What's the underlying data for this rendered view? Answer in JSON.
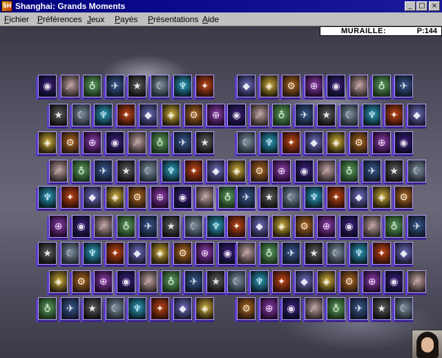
{
  "window": {
    "title": "Shanghai: Grands Moments",
    "icon": "shanghai-app-icon",
    "buttons": [
      "minimize",
      "maximize",
      "close"
    ]
  },
  "menu": [
    "Fichier",
    "Préférences",
    "Jeux",
    "Payés",
    "Présentations",
    "Aide"
  ],
  "status": {
    "label": "MURAILLE:",
    "value": "P:144"
  },
  "board": {
    "layout": "muraille",
    "tile_count": 144,
    "tile_theme": "science-fiction movie stills",
    "tile_edge_color": "#5a3cc8",
    "tile_border_color": "#b8a0ff"
  },
  "colors": {
    "titlebar": "#000080",
    "menubar": "#c0c0c0",
    "background": "#5c5a6c"
  },
  "portrait": {
    "icon": "woman-portrait-photo"
  }
}
